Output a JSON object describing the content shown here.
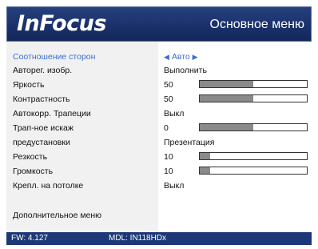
{
  "header": {
    "logo": "InFocus",
    "title": "Основное меню"
  },
  "menu": {
    "items": [
      {
        "label": "Соотношение сторон",
        "value": "Авто",
        "selected": true
      },
      {
        "label": "Авторег. изобр.",
        "value": "Выполнить"
      },
      {
        "label": "Яркость",
        "value": "50",
        "level": 0.5
      },
      {
        "label": "Контрастность",
        "value": "50",
        "level": 0.5
      },
      {
        "label": "Автокорр. Трапеции",
        "value": "Выкл"
      },
      {
        "label": "Трап-ное искаж",
        "value": "0",
        "level": 0.5
      },
      {
        "label": "предустановки",
        "value": "Презентация"
      },
      {
        "label": "Резкость",
        "value": "10",
        "level": 0.1
      },
      {
        "label": "Громкость",
        "value": "10",
        "level": 0.1
      },
      {
        "label": "Крепл. на потолке",
        "value": "Выкл"
      }
    ],
    "advanced": "Дополнительное меню"
  },
  "footer": {
    "fw": "FW: 4.127",
    "mdl": "MDL: IN118HDx"
  },
  "colors": {
    "header_bg": "#19306a",
    "selected_text": "#3c6fd0",
    "bar_fill": "#8a8a8a",
    "footer_bg": "#1e3877"
  }
}
